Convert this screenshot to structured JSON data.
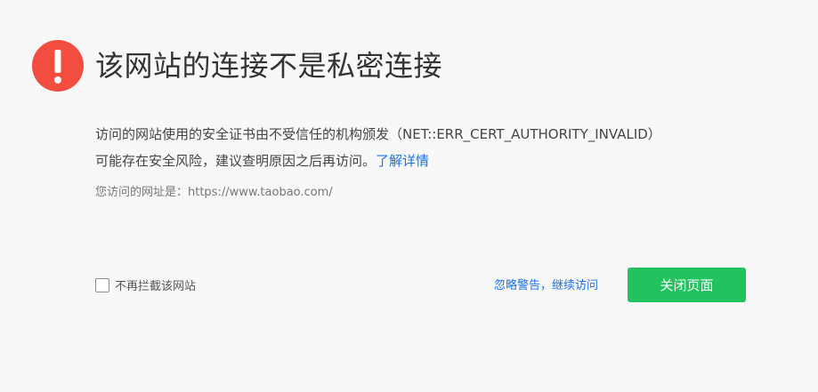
{
  "colors": {
    "warning_red": "#f24d3e",
    "link_blue": "#1a73e8",
    "button_green": "#22c35e",
    "background": "#f8f8f8"
  },
  "icon": "exclamation-warning-icon",
  "title": "该网站的连接不是私密连接",
  "description": {
    "line1": "访问的网站使用的安全证书由不受信任的机构颁发（NET::ERR_CERT_AUTHORITY_INVALID）",
    "line2_prefix": "可能存在安全风险，建议查明原因之后再访问。",
    "learn_more": "了解详情"
  },
  "url_line": "您访问的网址是：https://www.taobao.com/",
  "checkbox": {
    "label": "不再拦截该网站",
    "checked": false
  },
  "ignore_link": "忽略警告，继续访问",
  "close_button": "关闭页面"
}
